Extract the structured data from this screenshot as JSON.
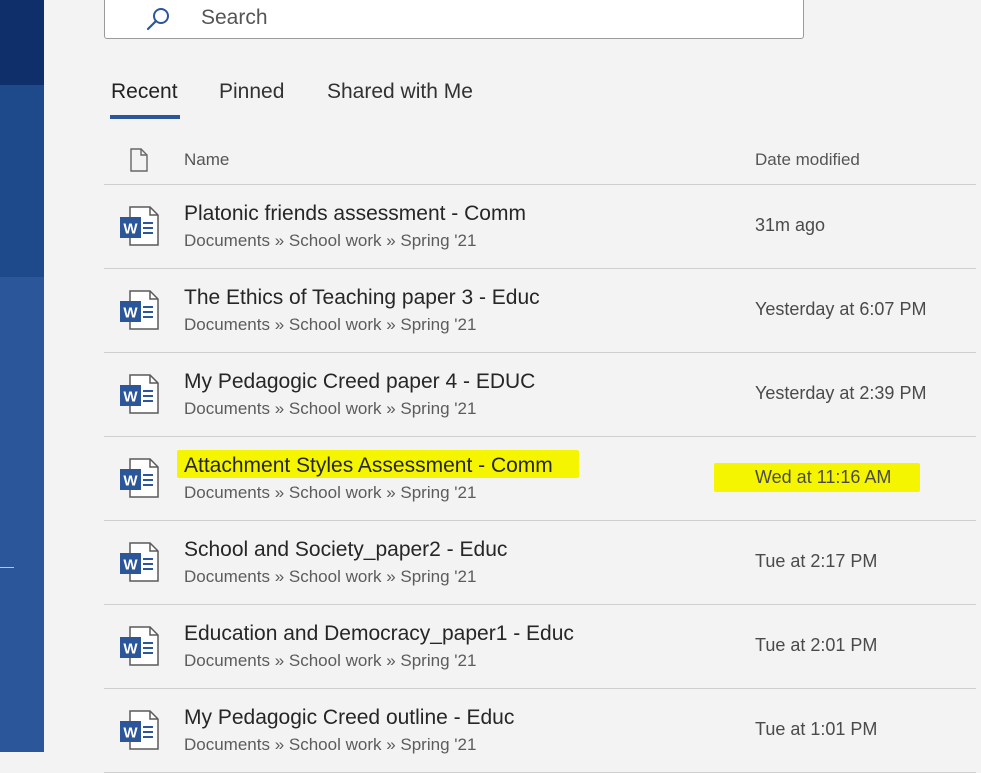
{
  "search": {
    "placeholder": "Search"
  },
  "tabs": [
    {
      "label": "Recent",
      "active": true
    },
    {
      "label": "Pinned",
      "active": false
    },
    {
      "label": "Shared with Me",
      "active": false
    }
  ],
  "table": {
    "headers": {
      "name": "Name",
      "date": "Date modified"
    },
    "rows": [
      {
        "name": "Platonic friends assessment - Comm",
        "path": "Documents » School work » Spring '21",
        "date": "31m ago",
        "highlighted": false
      },
      {
        "name": "The Ethics of Teaching paper 3 - Educ",
        "path": "Documents » School work » Spring '21",
        "date": "Yesterday at 6:07 PM",
        "highlighted": false
      },
      {
        "name": "My Pedagogic Creed paper 4 - EDUC",
        "path": "Documents » School work » Spring '21",
        "date": "Yesterday at 2:39 PM",
        "highlighted": false
      },
      {
        "name": "Attachment Styles Assessment - Comm",
        "path": "Documents » School work » Spring '21",
        "date": "Wed at 11:16 AM",
        "highlighted": true
      },
      {
        "name": "School and Society_paper2 - Educ",
        "path": "Documents » School work » Spring '21",
        "date": "Tue at 2:17 PM",
        "highlighted": false
      },
      {
        "name": "Education and Democracy_paper1 - Educ",
        "path": "Documents » School work » Spring '21",
        "date": "Tue at 2:01 PM",
        "highlighted": false
      },
      {
        "name": "My Pedagogic Creed outline - Educ",
        "path": "Documents » School work » Spring '21",
        "date": "Tue at 1:01 PM",
        "highlighted": false
      }
    ]
  },
  "colors": {
    "accent": "#2b579a",
    "highlight": "#f5f500",
    "word_icon": "#2b579a"
  },
  "icons": {
    "search": "search-icon",
    "file_header": "document-icon",
    "row": "word-document-icon"
  }
}
